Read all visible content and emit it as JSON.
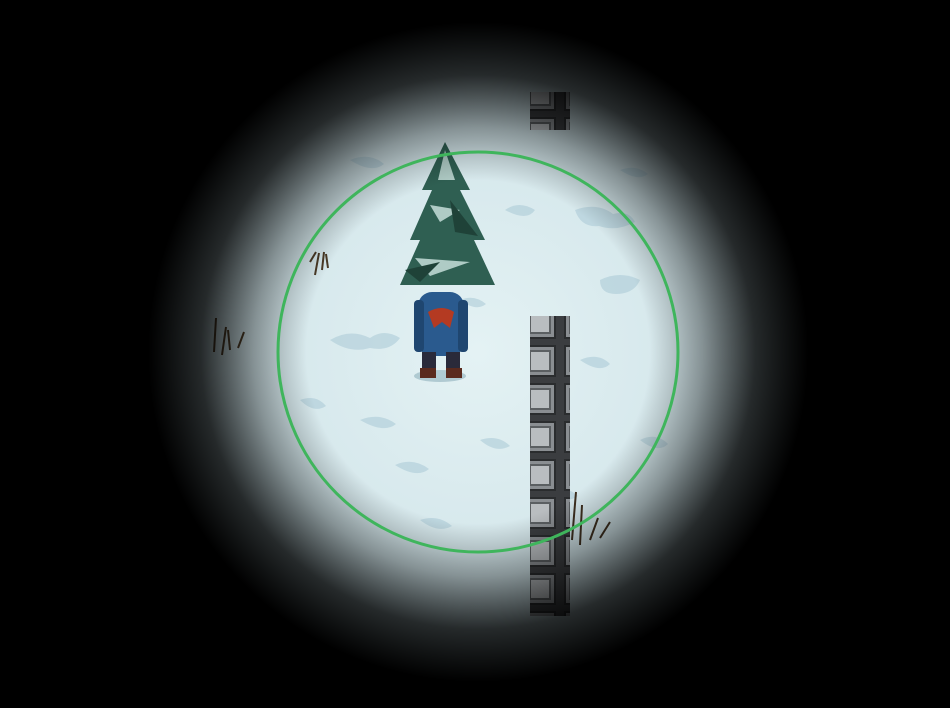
{
  "game": {
    "scene": "snowfield-night",
    "player": {
      "facing": "up",
      "cloak_color": "#2a5a8e",
      "scarf_color": "#b43a22"
    },
    "interaction_ring": {
      "color": "#3fb55c"
    },
    "environment": {
      "snow_color": "#dfeff1",
      "snow_shadow_color": "#aacbd8",
      "tree_color": "#2f5f52",
      "block_color": "#6e7276"
    },
    "icons": {
      "tree": "pine-tree-icon",
      "block": "stone-block-icon",
      "weed": "dry-weed-icon",
      "player": "player-sprite-icon"
    }
  }
}
